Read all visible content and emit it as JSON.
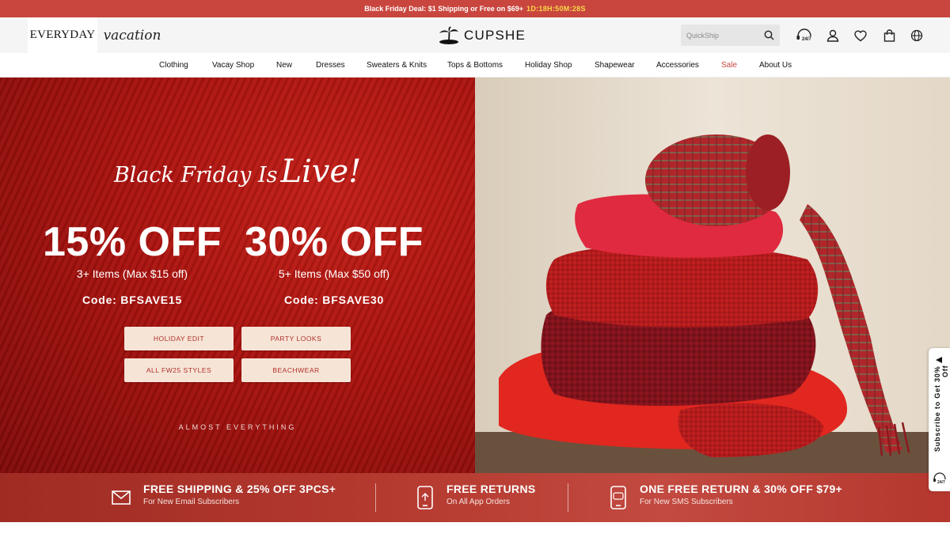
{
  "promo": {
    "text": "Black Friday Deal: $1 Shipping or Free on $69+",
    "timer": "1D:18H:50M:28S"
  },
  "header": {
    "brand_tabs": [
      "EVERYDAY",
      "vacation"
    ],
    "logo_text": "CUPSHE",
    "search_placeholder": "QuickShip",
    "icons": [
      "support-24-7-icon",
      "account-icon",
      "wishlist-heart-icon",
      "bag-icon",
      "globe-icon"
    ]
  },
  "nav": {
    "items": [
      "Clothing",
      "Vacay Shop",
      "New",
      "Dresses",
      "Sweaters & Knits",
      "Tops & Bottoms",
      "Holiday Shop",
      "Shapewear",
      "Accessories",
      "Sale",
      "About Us"
    ]
  },
  "hero": {
    "headline_a": "Black Friday Is",
    "headline_b": "Live!",
    "offers": [
      {
        "big": "15% OFF",
        "sub": "3+ Items (Max $15 off)",
        "code": "Code: BFSAVE15"
      },
      {
        "big": "30% OFF",
        "sub": "5+ Items (Max $50 off)",
        "code": "Code: BFSAVE30"
      }
    ],
    "buttons": [
      "HOLIDAY EDIT",
      "PARTY LOOKS",
      "ALL FW25 STYLES",
      "BEACHWEAR"
    ],
    "footnote": "ALMOST EVERYTHING"
  },
  "side_tab": {
    "text": "Subscribe to Get 30% Off",
    "chat_badge": "24/7"
  },
  "benefits": [
    {
      "title": "FREE SHIPPING & 25% OFF 3PCS+",
      "sub": "For New Email Subscribers",
      "icon": "envelope-icon"
    },
    {
      "title": "FREE RETURNS",
      "sub": "On All App Orders",
      "icon": "phone-app-icon"
    },
    {
      "title": "ONE FREE RETURN & 30% OFF $79+",
      "sub": "For New SMS Subscribers",
      "icon": "phone-sms-icon"
    }
  ],
  "colors": {
    "promo_bg": "#c9463e",
    "timer": "#f8d94a",
    "sale": "#c8453e",
    "cta_bg": "#f6e4d6",
    "cta_text": "#b0302a"
  }
}
